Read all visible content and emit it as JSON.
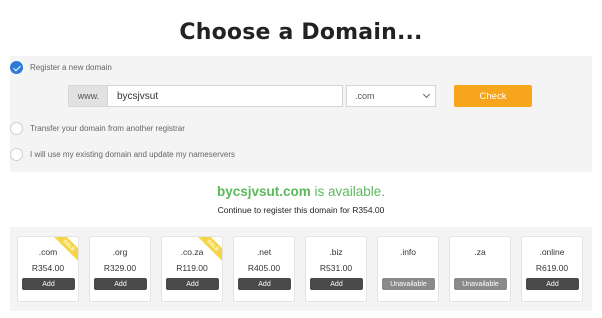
{
  "title": "Choose a Domain...",
  "options": [
    {
      "label": "Register a new domain",
      "checked": true
    },
    {
      "label": "Transfer your domain from another registrar",
      "checked": false
    },
    {
      "label": "I will use my existing domain and update my nameservers",
      "checked": false
    }
  ],
  "search": {
    "prefix": "www.",
    "value": "bycsjvsut",
    "tld_selected": ".com",
    "check_label": "Check"
  },
  "result": {
    "domain": "bycsjvsut.com",
    "status": " is available.",
    "subtext": "Continue to register this domain for R354.00"
  },
  "colors": {
    "accent_blue": "#2b7bd6",
    "check_orange": "#f7a51c",
    "available_green": "#5cb85c",
    "sale_yellow": "#f5d547"
  },
  "tlds": [
    {
      "tld": ".com",
      "price": "R354.00",
      "action": "Add",
      "sale": true,
      "sale_label": "SALE"
    },
    {
      "tld": ".org",
      "price": "R329.00",
      "action": "Add",
      "sale": false
    },
    {
      "tld": ".co.za",
      "price": "R119.00",
      "action": "Add",
      "sale": true,
      "sale_label": "SALE"
    },
    {
      "tld": ".net",
      "price": "R405.00",
      "action": "Add",
      "sale": false
    },
    {
      "tld": ".biz",
      "price": "R531.00",
      "action": "Add",
      "sale": false
    },
    {
      "tld": ".info",
      "price": "",
      "action": "Unavailable",
      "sale": false
    },
    {
      "tld": ".za",
      "price": "",
      "action": "Unavailable",
      "sale": false
    },
    {
      "tld": ".online",
      "price": "R619.00",
      "action": "Add",
      "sale": false
    }
  ]
}
